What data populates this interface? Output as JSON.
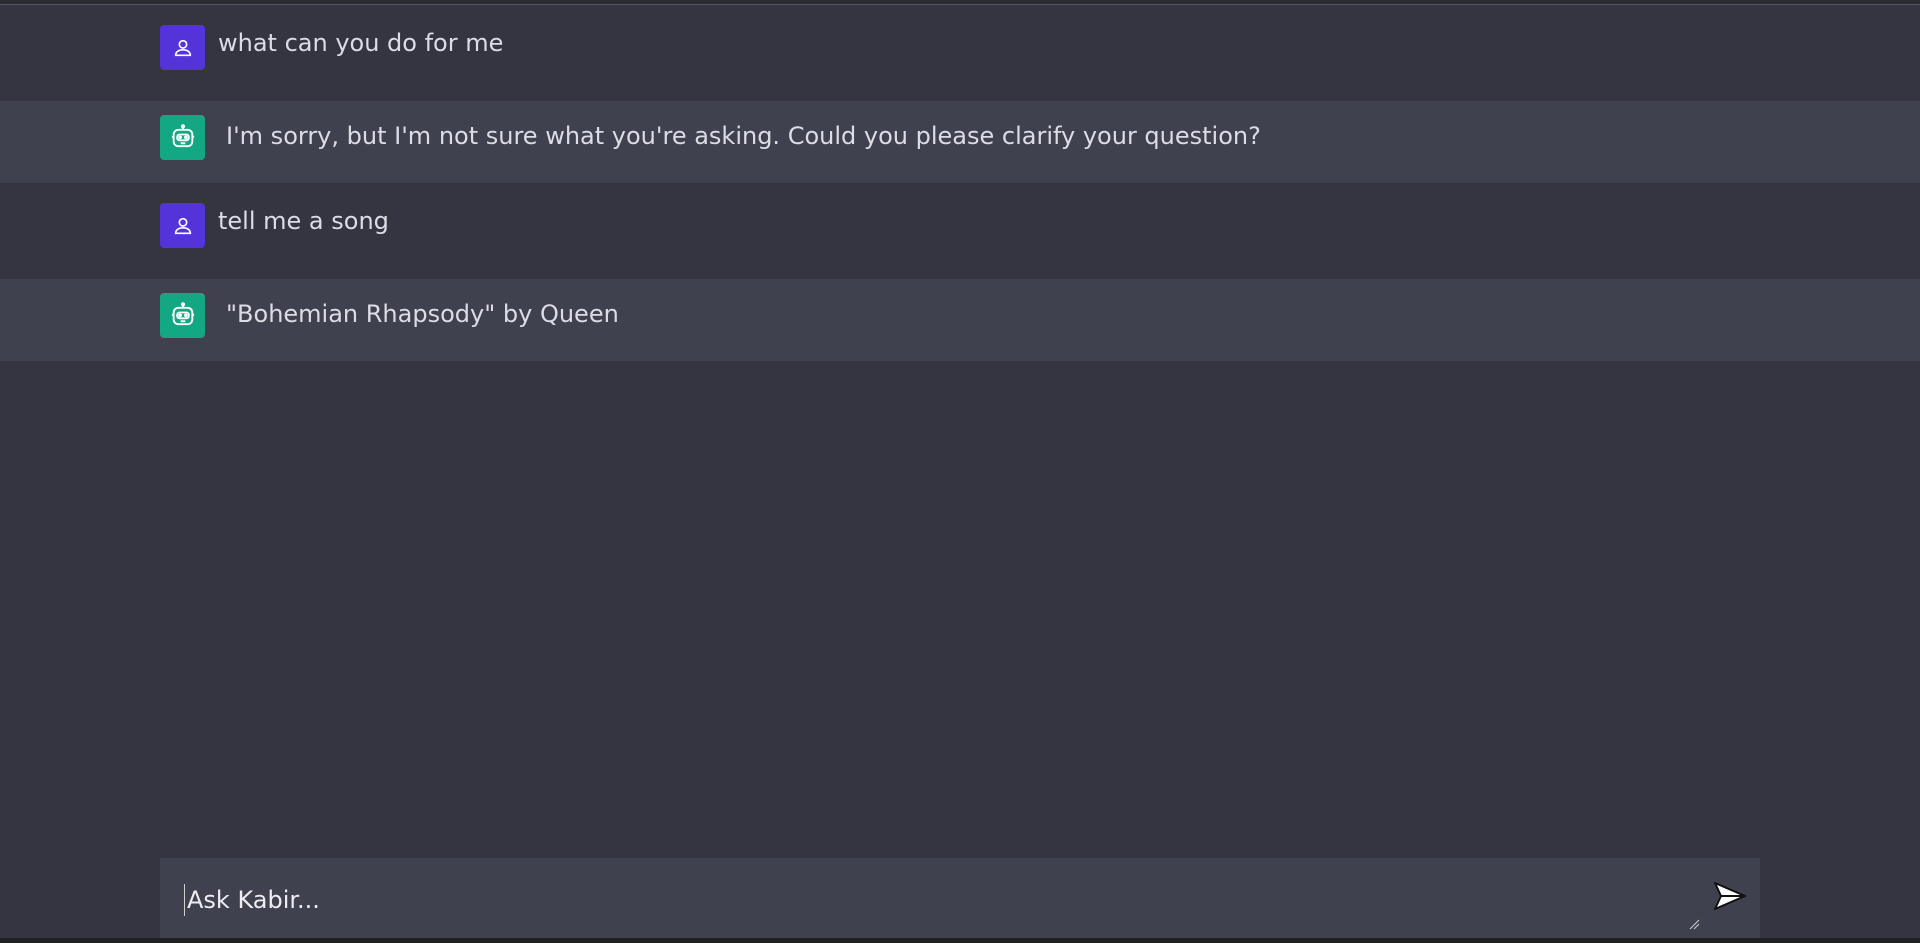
{
  "conversation": {
    "messages": [
      {
        "role": "user",
        "avatar_icon": "user-icon",
        "text": "what can you do for me"
      },
      {
        "role": "assistant",
        "avatar_icon": "robot-icon",
        "text": "I'm sorry, but I'm not sure what you're asking. Could you please clarify your question?"
      },
      {
        "role": "user",
        "avatar_icon": "user-icon",
        "text": "tell me a song"
      },
      {
        "role": "assistant",
        "avatar_icon": "robot-icon",
        "text": "\"Bohemian Rhapsody\" by Queen"
      }
    ]
  },
  "composer": {
    "placeholder": "Ask Kabir...",
    "value": "",
    "send_icon": "send-icon"
  },
  "colors": {
    "background": "#343541",
    "assistant_row": "#40414f",
    "user_avatar": "#5433d9",
    "assistant_avatar": "#13a883"
  }
}
